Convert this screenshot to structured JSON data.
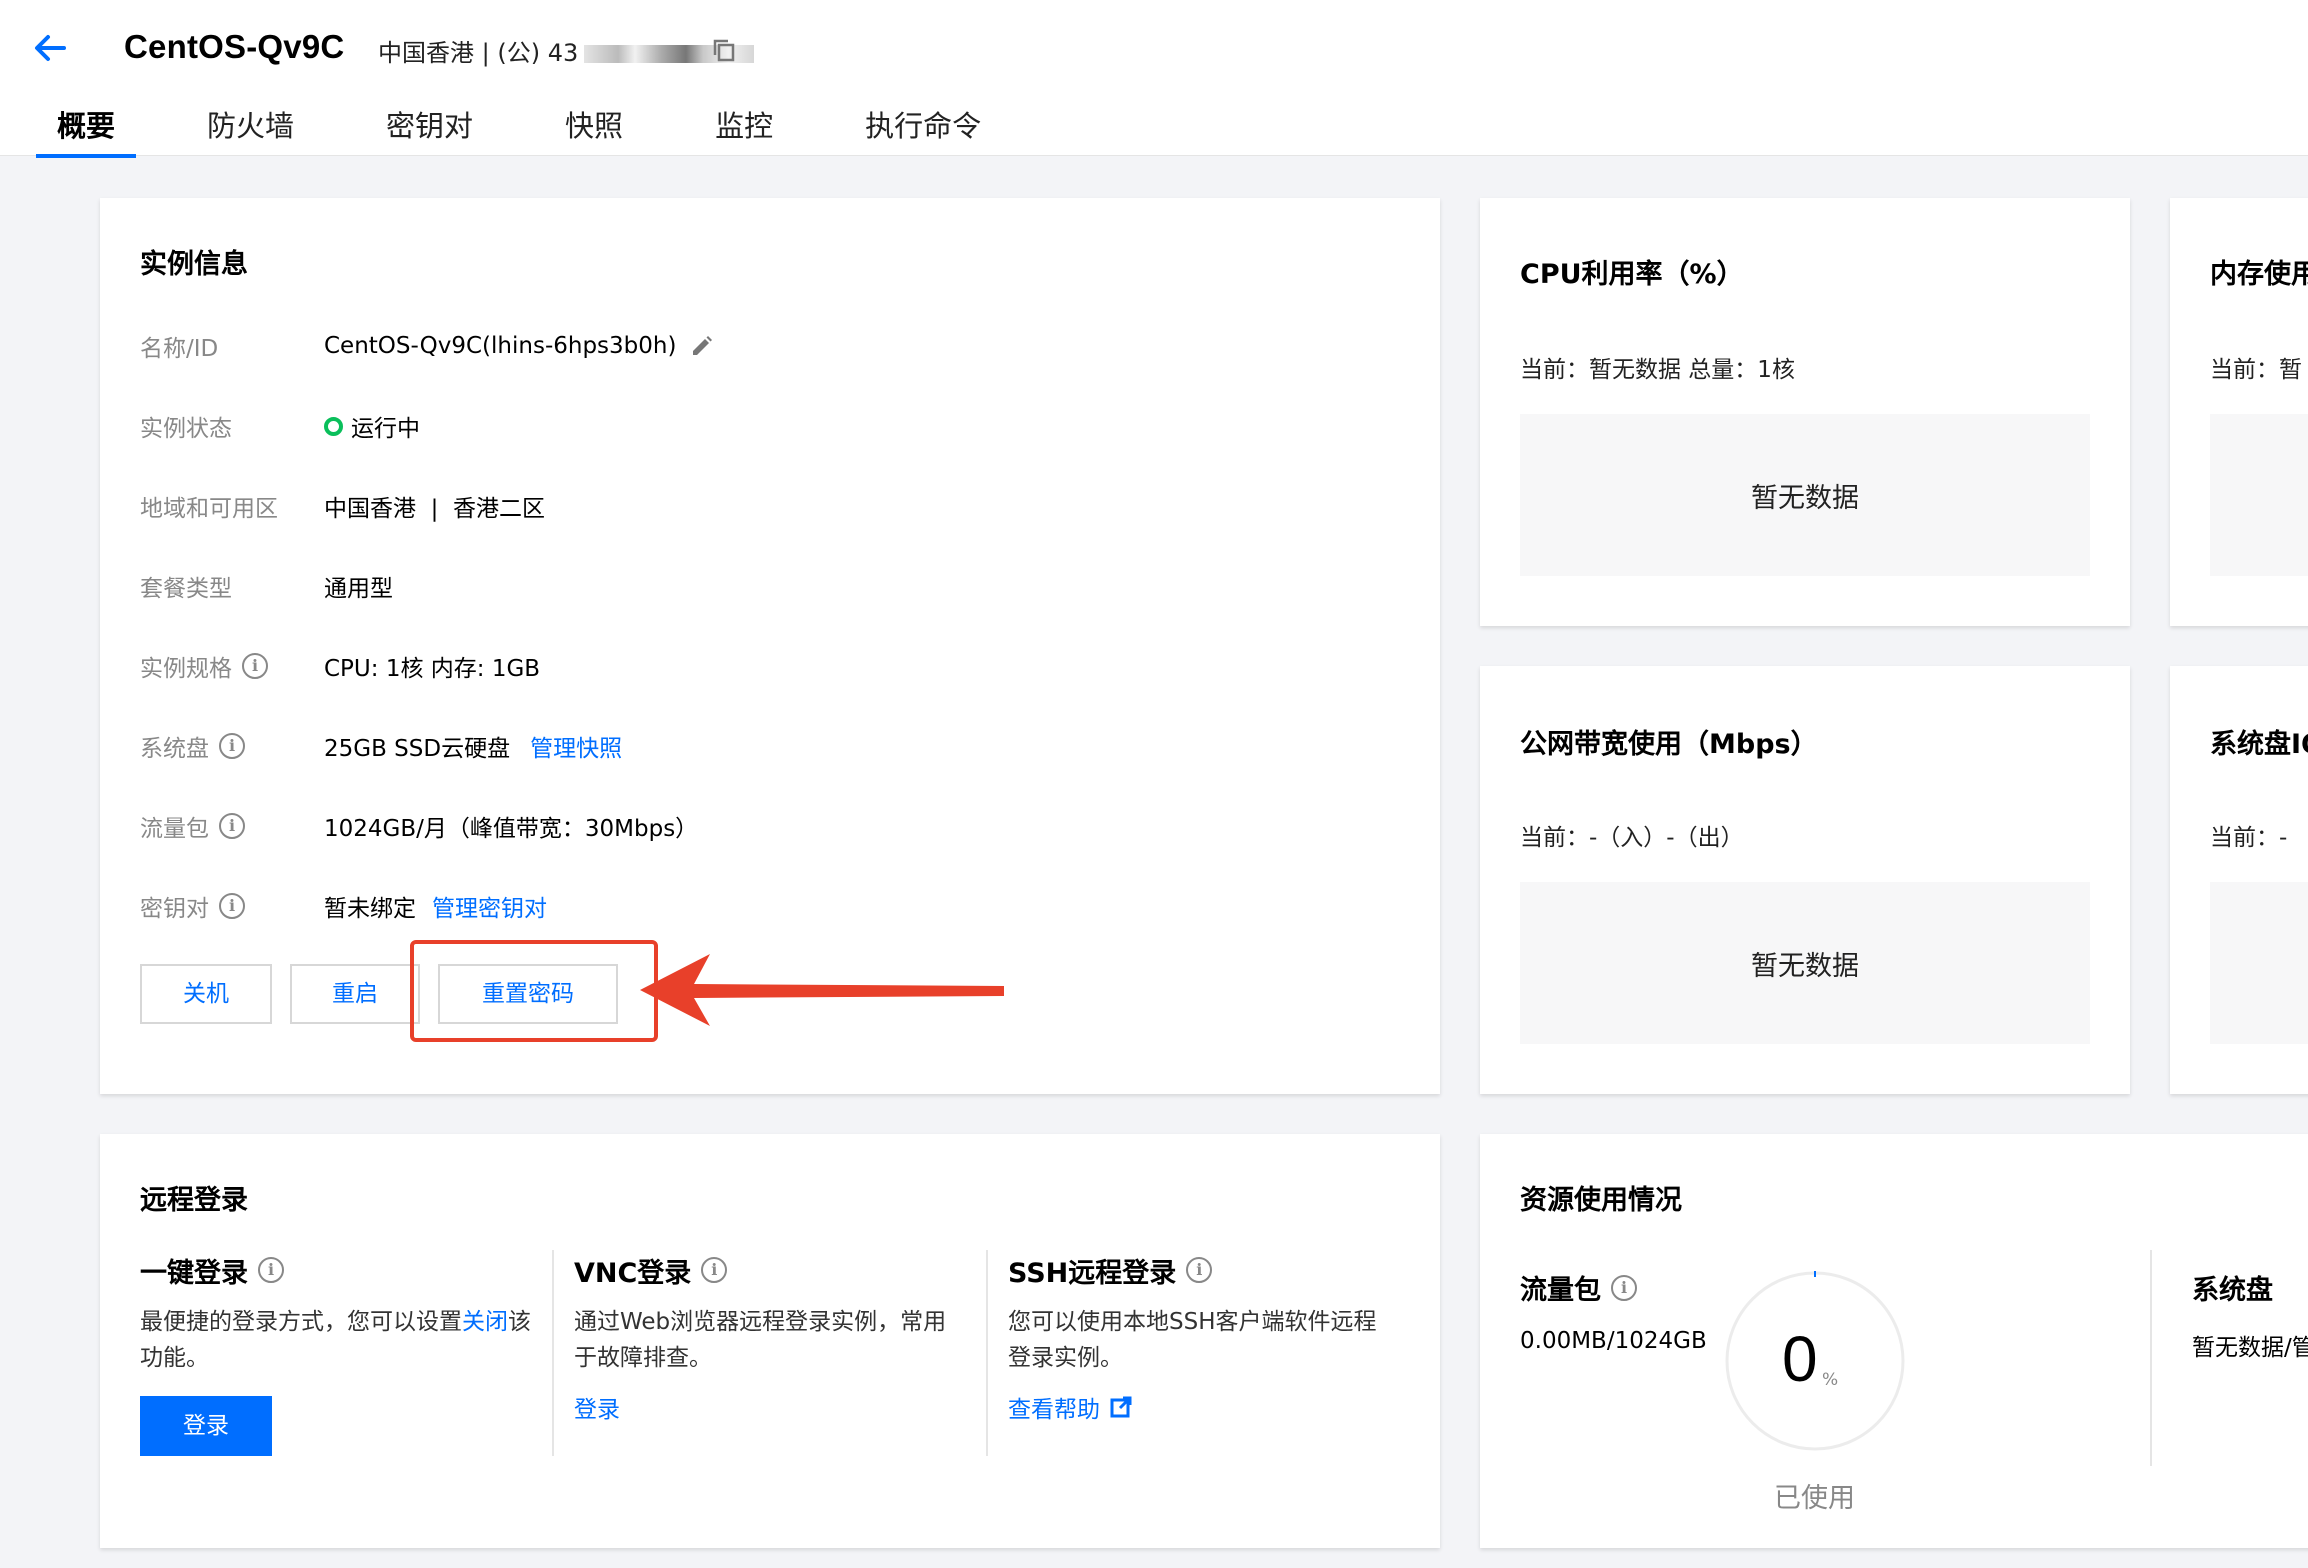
{
  "header": {
    "title": "CentOS-Qv9C",
    "region_prefix": "中国香港 | (公)",
    "ip_partial": "43"
  },
  "tabs": [
    {
      "label": "概要",
      "active": true
    },
    {
      "label": "防火墙"
    },
    {
      "label": "密钥对"
    },
    {
      "label": "快照"
    },
    {
      "label": "监控"
    },
    {
      "label": "执行命令"
    }
  ],
  "instance_info": {
    "title": "实例信息",
    "rows": {
      "name": {
        "label": "名称/ID",
        "value": "CentOS-Qv9C(lhins-6hps3b0h)"
      },
      "status": {
        "label": "实例状态",
        "value": "运行中"
      },
      "region": {
        "label": "地域和可用区",
        "value": "中国香港  |  香港二区"
      },
      "plan": {
        "label": "套餐类型",
        "value": "通用型"
      },
      "spec": {
        "label": "实例规格",
        "value": "CPU: 1核 内存: 1GB"
      },
      "disk": {
        "label": "系统盘",
        "value": "25GB SSD云硬盘",
        "link": "管理快照"
      },
      "traffic": {
        "label": "流量包",
        "value": "1024GB/月（峰值带宽：30Mbps）"
      },
      "keypair": {
        "label": "密钥对",
        "value": "暂未绑定",
        "link": "管理密钥对"
      }
    },
    "buttons": {
      "shutdown": "关机",
      "restart": "重启",
      "reset_password": "重置密码"
    }
  },
  "monitors": {
    "cpu": {
      "title": "CPU利用率（%）",
      "current": "当前：暂无数据 总量：1核",
      "nodata": "暂无数据"
    },
    "memory": {
      "title": "内存使用",
      "current": "当前：暂"
    },
    "bandwidth": {
      "title": "公网带宽使用（Mbps）",
      "current": "当前：-（入）-（出）",
      "nodata": "暂无数据"
    },
    "sysdisk": {
      "title": "系统盘IO",
      "current": "当前：-"
    }
  },
  "remote_login": {
    "title": "远程登录",
    "one_click": {
      "title": "一键登录",
      "desc": "最便捷的登录方式，您可以设置",
      "desc_link": "关闭",
      "desc_tail": "该功能。",
      "button": "登录"
    },
    "vnc": {
      "title": "VNC登录",
      "desc": "通过Web浏览器远程登录实例，常用于故障排查。",
      "link": "登录"
    },
    "ssh": {
      "title": "SSH远程登录",
      "desc": "您可以使用本地SSH客户端软件远程登录实例。",
      "link": "查看帮助"
    }
  },
  "resource_usage": {
    "title": "资源使用情况",
    "traffic": {
      "label": "流量包",
      "value": "0.00MB/1024GB",
      "percent": "0",
      "unit": "%",
      "caption": "已使用"
    },
    "sysdisk": {
      "label": "系统盘",
      "value": "暂无数据/管"
    }
  },
  "colors": {
    "accent": "#006eff",
    "status_running": "#0abf5b",
    "annotation": "#e8402a"
  }
}
